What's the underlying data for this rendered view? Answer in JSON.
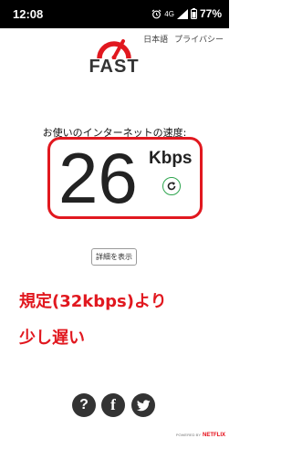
{
  "status_bar": {
    "time": "12:08",
    "battery_percent": "77%",
    "network_label": "4G"
  },
  "header": {
    "logo_text": "FAST",
    "language_link": "日本語",
    "privacy_link": "プライバシー"
  },
  "speed": {
    "label": "お使いのインターネットの速度:",
    "value": "26",
    "unit": "Kbps"
  },
  "details_button_label": "詳細を表示",
  "annotation": {
    "line1": "規定(32kbps)より",
    "line2": "少し遅い"
  },
  "social": {
    "help_label": "?",
    "facebook_label": "f"
  },
  "footer": {
    "powered_by": "POWERED BY",
    "brand": "NETFLIX"
  },
  "colors": {
    "accent_red": "#e1181f",
    "refresh_green": "#2da44e",
    "dark": "#333333"
  }
}
